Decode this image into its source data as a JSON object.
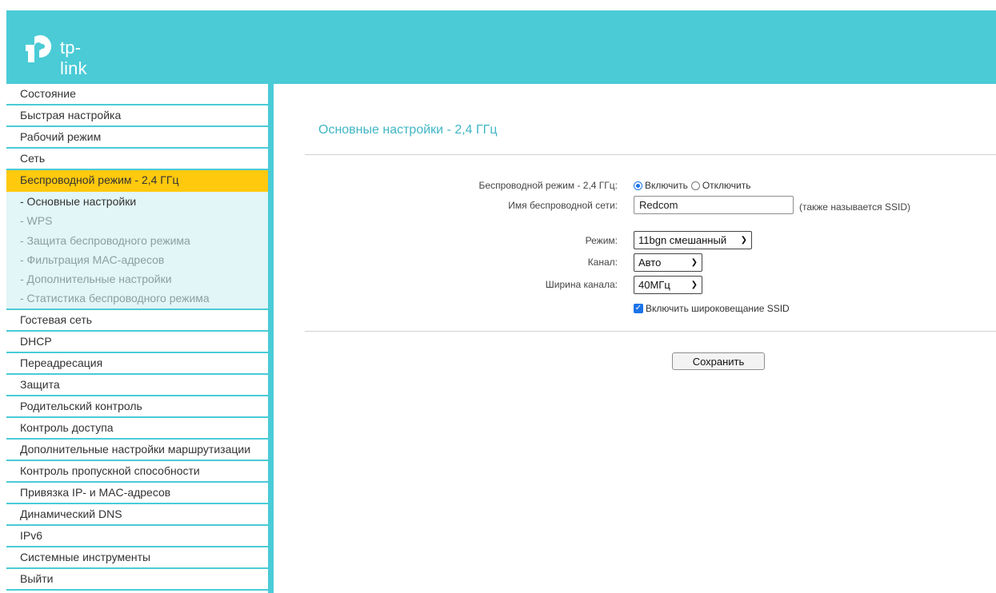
{
  "header": {
    "brand": "tp-link"
  },
  "sidebar": {
    "items_before": [
      {
        "label": "Состояние"
      },
      {
        "label": "Быстрая настройка"
      },
      {
        "label": "Рабочий режим"
      },
      {
        "label": "Сеть"
      }
    ],
    "active": {
      "label": "Беспроводной режим - 2,4 ГГц"
    },
    "submenu": [
      {
        "label": "- Основные настройки"
      },
      {
        "label": "- WPS"
      },
      {
        "label": "- Защита беспроводного режима"
      },
      {
        "label": "- Фильтрация MAC-адресов"
      },
      {
        "label": "- Дополнительные настройки"
      },
      {
        "label": "- Статистика беспроводного режима"
      }
    ],
    "items_after": [
      {
        "label": "Гостевая сеть"
      },
      {
        "label": "DHCP"
      },
      {
        "label": "Переадресация"
      },
      {
        "label": "Защита"
      },
      {
        "label": "Родительский контроль"
      },
      {
        "label": "Контроль доступа"
      },
      {
        "label": "Дополнительные настройки маршрутизации"
      },
      {
        "label": "Контроль пропускной способности"
      },
      {
        "label": "Привязка IP- и MAC-адресов"
      },
      {
        "label": "Динамический DNS"
      },
      {
        "label": "IPv6"
      },
      {
        "label": "Системные инструменты"
      },
      {
        "label": "Выйти"
      }
    ]
  },
  "main": {
    "title": "Основные настройки - 2,4 ГГц",
    "wireless": {
      "label": "Беспроводной режим - 2,4 ГГц:",
      "enable": "Включить",
      "disable": "Отключить"
    },
    "ssid": {
      "label": "Имя беспроводной сети:",
      "value": "Redcom",
      "hint": "(также называется SSID)"
    },
    "mode": {
      "label": "Режим:",
      "value": "11bgn смешанный"
    },
    "channel": {
      "label": "Канал:",
      "value": "Авто"
    },
    "width": {
      "label": "Ширина канала:",
      "value": "40МГц"
    },
    "broadcast": {
      "label": "Включить широковещание SSID"
    },
    "save_label": "Сохранить"
  },
  "colors": {
    "accent": "#4acbd6",
    "active": "#ffc90e",
    "title": "#41b6c5",
    "control": "#1a73e8"
  }
}
